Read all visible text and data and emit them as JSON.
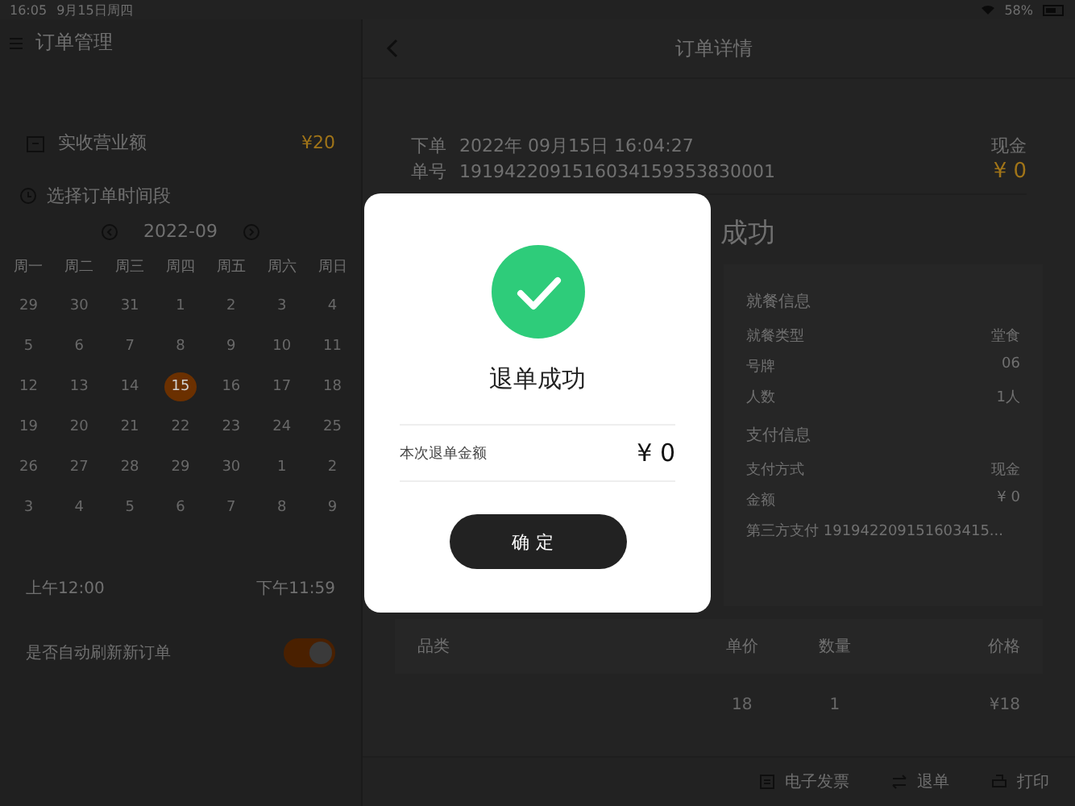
{
  "status_bar": {
    "time": "16:05",
    "date": "9月15日周四",
    "battery": "58%"
  },
  "sidebar": {
    "title": "订单管理",
    "revenue": {
      "label": "实收营业额",
      "value": "¥20"
    },
    "period_label": "选择订单时间段",
    "month": "2022-09",
    "weekdays": [
      "周一",
      "周二",
      "周三",
      "周四",
      "周五",
      "周六",
      "周日"
    ],
    "days": [
      {
        "label": "29",
        "selected": false
      },
      {
        "label": "30",
        "selected": false
      },
      {
        "label": "31",
        "selected": false
      },
      {
        "label": "1",
        "selected": false
      },
      {
        "label": "2",
        "selected": false
      },
      {
        "label": "3",
        "selected": false
      },
      {
        "label": "4",
        "selected": false
      },
      {
        "label": "5",
        "selected": false
      },
      {
        "label": "6",
        "selected": false
      },
      {
        "label": "7",
        "selected": false
      },
      {
        "label": "8",
        "selected": false
      },
      {
        "label": "9",
        "selected": false
      },
      {
        "label": "10",
        "selected": false
      },
      {
        "label": "11",
        "selected": false
      },
      {
        "label": "12",
        "selected": false
      },
      {
        "label": "13",
        "selected": false
      },
      {
        "label": "14",
        "selected": false
      },
      {
        "label": "15",
        "selected": true
      },
      {
        "label": "16",
        "selected": false
      },
      {
        "label": "17",
        "selected": false
      },
      {
        "label": "18",
        "selected": false
      },
      {
        "label": "19",
        "selected": false
      },
      {
        "label": "20",
        "selected": false
      },
      {
        "label": "21",
        "selected": false
      },
      {
        "label": "22",
        "selected": false
      },
      {
        "label": "23",
        "selected": false
      },
      {
        "label": "24",
        "selected": false
      },
      {
        "label": "25",
        "selected": false
      },
      {
        "label": "26",
        "selected": false
      },
      {
        "label": "27",
        "selected": false
      },
      {
        "label": "28",
        "selected": false
      },
      {
        "label": "29",
        "selected": false
      },
      {
        "label": "30",
        "selected": false
      },
      {
        "label": "1",
        "selected": false
      },
      {
        "label": "2",
        "selected": false
      },
      {
        "label": "3",
        "selected": false
      },
      {
        "label": "4",
        "selected": false
      },
      {
        "label": "5",
        "selected": false
      },
      {
        "label": "6",
        "selected": false
      },
      {
        "label": "7",
        "selected": false
      },
      {
        "label": "8",
        "selected": false
      },
      {
        "label": "9",
        "selected": false
      }
    ],
    "start_time": "上午12:00",
    "end_time": "下午11:59",
    "auto_refresh": {
      "label": "是否自动刷新新订单",
      "on": true
    }
  },
  "detail": {
    "title": "订单详情",
    "order_time_label": "下单",
    "order_time": "2022年 09月15日 16:04:27",
    "order_no_label": "单号",
    "order_no": "1919422091516034159353830001",
    "pay_type": "现金",
    "total": "¥ 0",
    "status_partial": "成功",
    "sections": [
      {
        "title": "就餐信息",
        "rows": [
          {
            "label": "就餐类型",
            "value": "堂食"
          },
          {
            "label": "号牌",
            "value": "06"
          },
          {
            "label": "人数",
            "value": "1人"
          }
        ]
      },
      {
        "title": "支付信息",
        "rows": [
          {
            "label": "支付方式",
            "value": "现金"
          },
          {
            "label": "金额",
            "value": "¥ 0"
          }
        ],
        "third_party": "第三方支付 191942209151603415..."
      }
    ],
    "table": {
      "columns": [
        "品类",
        "单价",
        "数量",
        "价格"
      ],
      "rows": [
        [
          "",
          "18",
          "1",
          "¥18"
        ]
      ]
    },
    "actions": [
      {
        "kind": "invoice",
        "label": "电子发票"
      },
      {
        "kind": "refund",
        "label": "退单"
      },
      {
        "kind": "print",
        "label": "打印"
      }
    ]
  },
  "dialog": {
    "title": "退单成功",
    "amount_label": "本次退单金额",
    "amount": "¥ 0",
    "button": "确定"
  }
}
